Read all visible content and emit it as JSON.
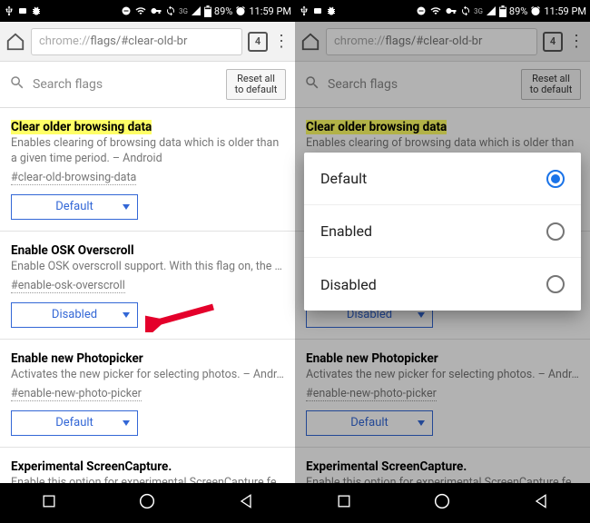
{
  "status": {
    "battery_text": "89%",
    "time": "11:59 PM",
    "network_label": "3G"
  },
  "chromebar": {
    "url_prefix": "chrome://",
    "url_rest": "flags/#clear-old-br",
    "tab_count": "4"
  },
  "search": {
    "placeholder": "Search flags",
    "reset_label": "Reset all to default"
  },
  "flags": [
    {
      "title": "Clear older browsing data",
      "highlight": true,
      "desc": "Enables clearing of browsing data which is older than a given time period. – Android",
      "anchor": "#clear-old-browsing-data",
      "value": "Default"
    },
    {
      "title": "Enable OSK Overscroll",
      "highlight": false,
      "desc": "Enable OSK overscroll support. With this flag on, the …",
      "anchor": "#enable-osk-overscroll",
      "value": "Disabled"
    },
    {
      "title": "Enable new Photopicker",
      "highlight": false,
      "desc": "Activates the new picker for selecting photos. – Andr…",
      "anchor": "#enable-new-photo-picker",
      "value": "Default"
    },
    {
      "title": "Experimental ScreenCapture.",
      "highlight": false,
      "desc": "Enable this option for experimental ScreenCapture fe",
      "anchor": "",
      "value": ""
    }
  ],
  "popup": {
    "options": [
      {
        "label": "Default",
        "selected": true
      },
      {
        "label": "Enabled",
        "selected": false
      },
      {
        "label": "Disabled",
        "selected": false
      }
    ]
  }
}
